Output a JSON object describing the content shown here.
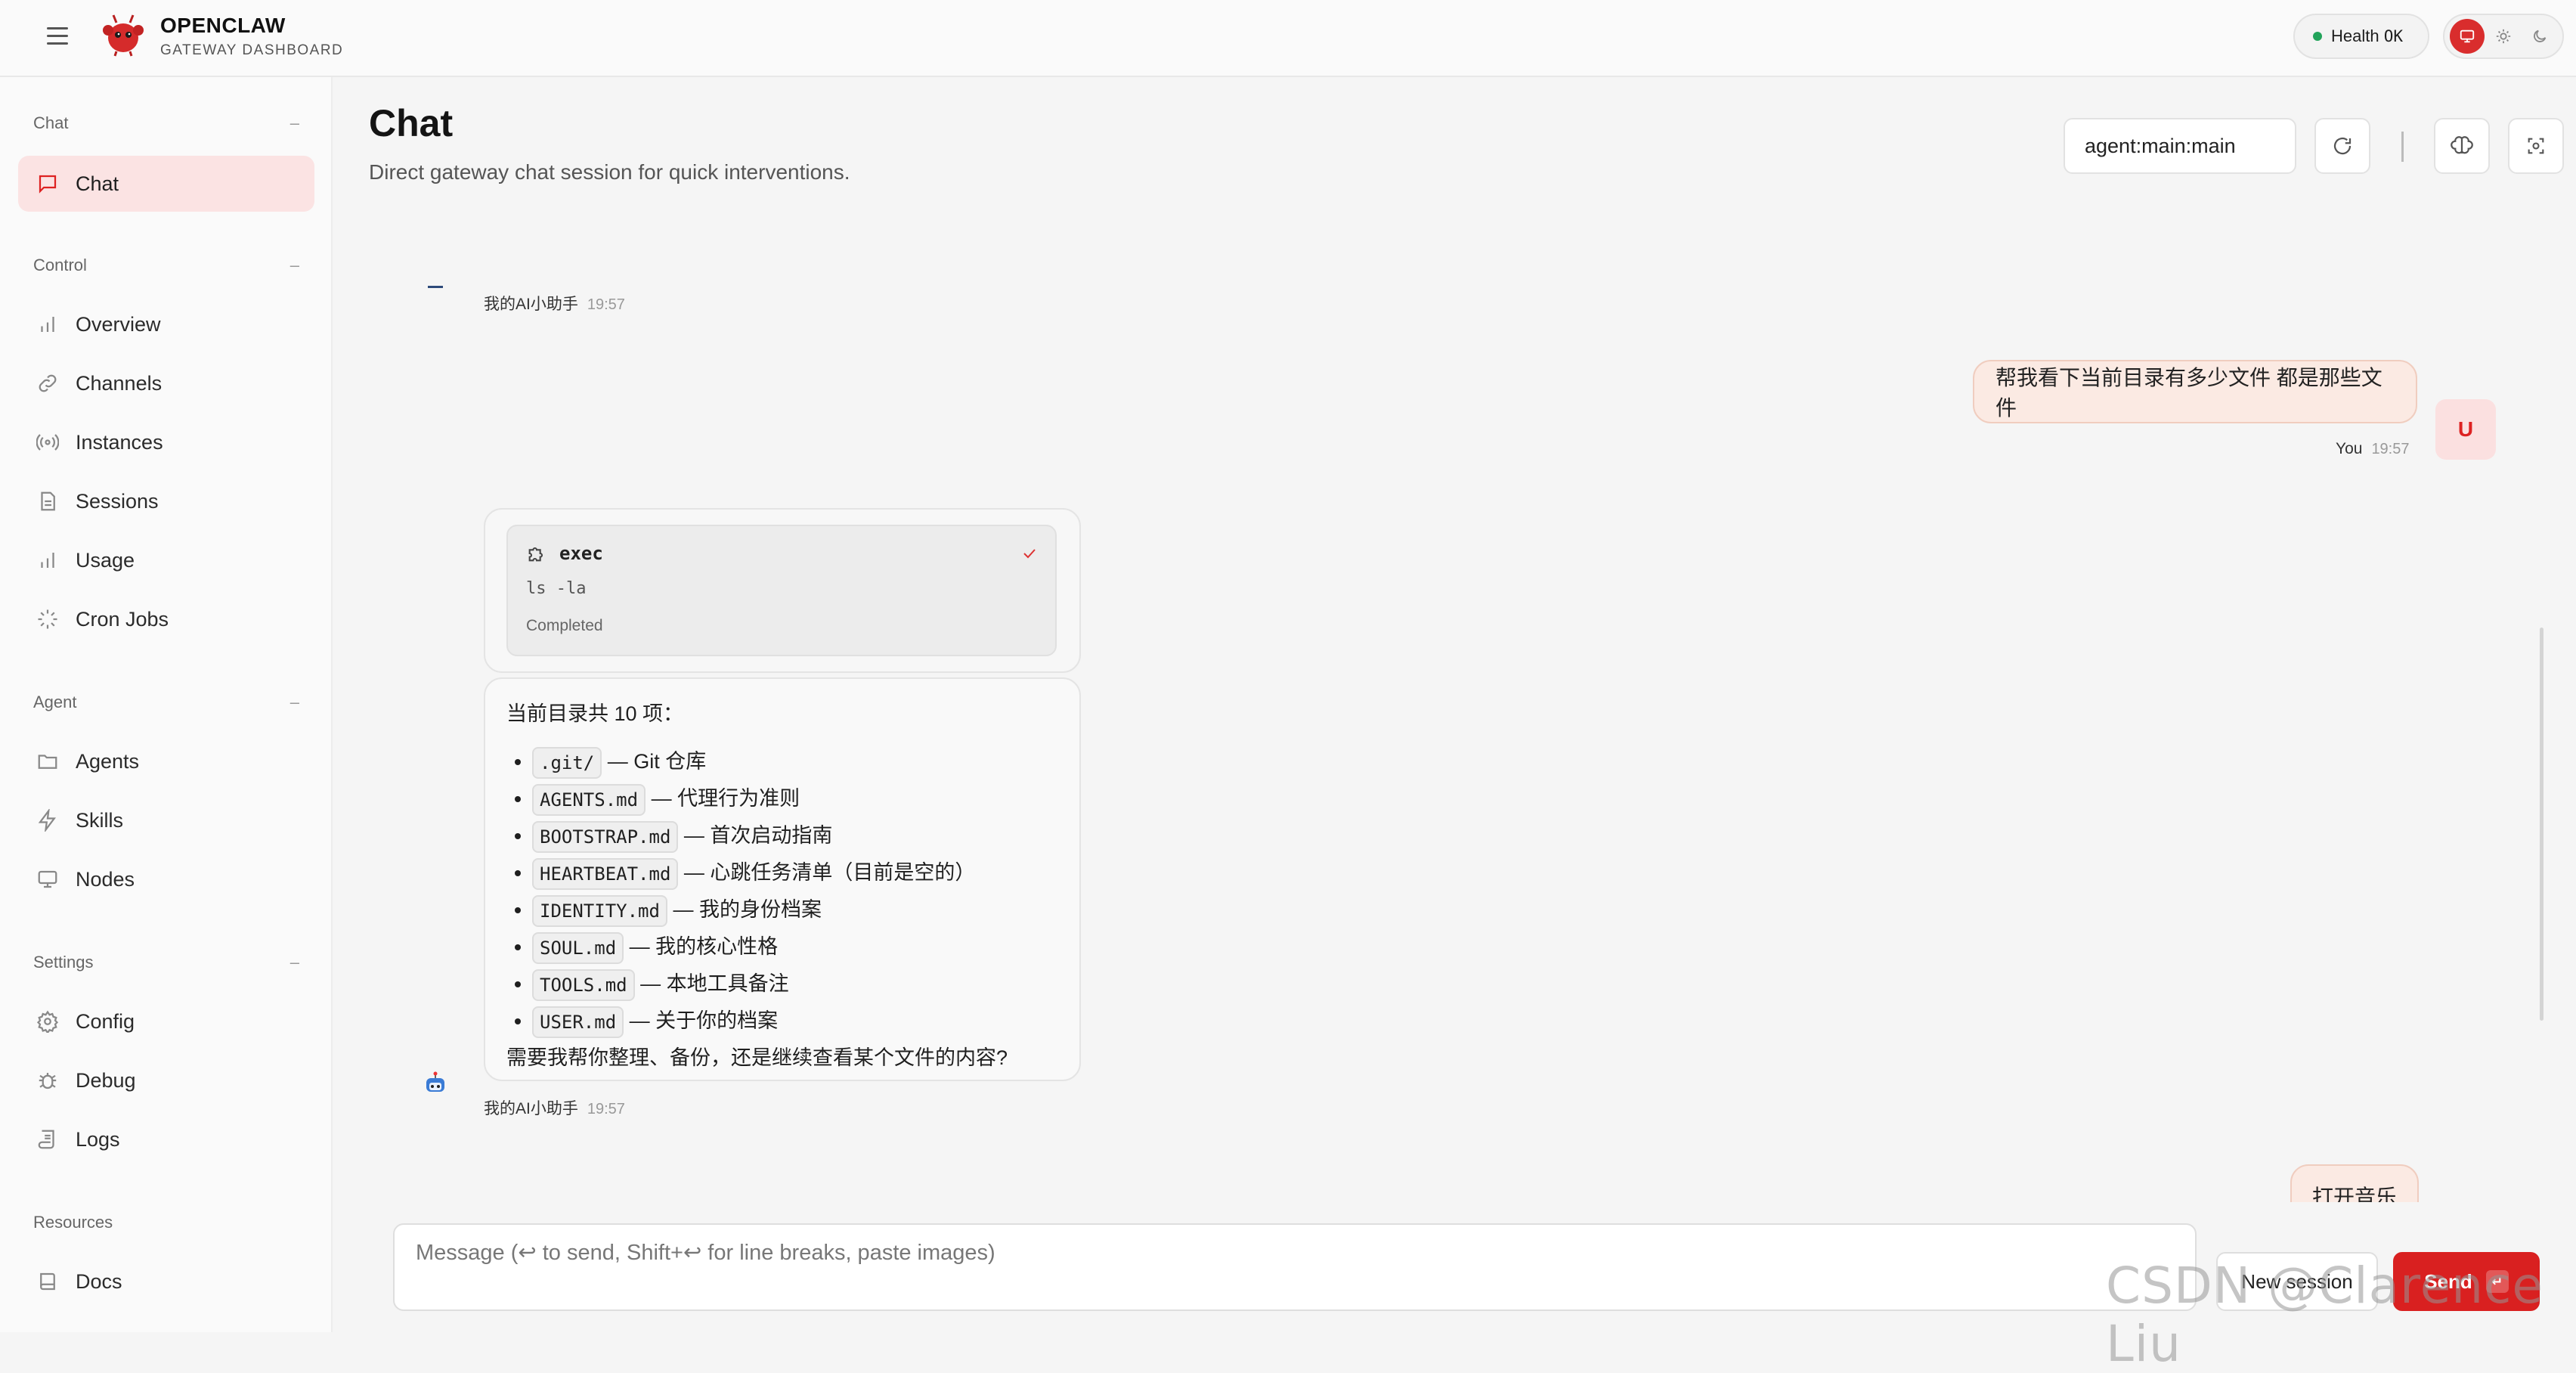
{
  "app": {
    "title": "OPENCLAW",
    "subtitle": "GATEWAY DASHBOARD",
    "health_label": "Health",
    "health_status": "OK",
    "accent": "#d92020"
  },
  "sidebar": {
    "sections": [
      {
        "title": "Chat",
        "collapse": "–"
      },
      {
        "title": "Control",
        "collapse": "–"
      },
      {
        "title": "Agent",
        "collapse": "–"
      },
      {
        "title": "Settings",
        "collapse": "–"
      },
      {
        "title": "Resources"
      }
    ],
    "items": [
      {
        "label": "Chat",
        "icon": "message-icon",
        "active": true
      },
      {
        "label": "Overview",
        "icon": "bar-chart-icon"
      },
      {
        "label": "Channels",
        "icon": "link-icon"
      },
      {
        "label": "Instances",
        "icon": "broadcast-icon"
      },
      {
        "label": "Sessions",
        "icon": "file-icon"
      },
      {
        "label": "Usage",
        "icon": "bar-chart-icon"
      },
      {
        "label": "Cron Jobs",
        "icon": "loader-icon"
      },
      {
        "label": "Agents",
        "icon": "folder-icon"
      },
      {
        "label": "Skills",
        "icon": "zap-icon"
      },
      {
        "label": "Nodes",
        "icon": "monitor-icon"
      },
      {
        "label": "Config",
        "icon": "gear-icon"
      },
      {
        "label": "Debug",
        "icon": "bug-icon"
      },
      {
        "label": "Logs",
        "icon": "scroll-icon"
      },
      {
        "label": "Docs",
        "icon": "book-icon"
      }
    ]
  },
  "page": {
    "title": "Chat",
    "subtitle": "Direct gateway chat session for quick interventions.",
    "session_key": "agent:main:main"
  },
  "messages": {
    "bot_name": "我的AI小助手",
    "first_time": "19:57",
    "user_msg": "帮我看下当前目录有多少文件 都是那些文件",
    "user_name": "You",
    "user_time": "19:57",
    "user_avatar": "U",
    "tool": {
      "name": "exec",
      "command": "ls -la",
      "status": "Completed"
    },
    "answer_intro": "当前目录共 10 项：",
    "files": [
      {
        "name": ".git/",
        "desc": "— Git 仓库"
      },
      {
        "name": "AGENTS.md",
        "desc": "— 代理行为准则"
      },
      {
        "name": "BOOTSTRAP.md",
        "desc": "— 首次启动指南"
      },
      {
        "name": "HEARTBEAT.md",
        "desc": "— 心跳任务清单（目前是空的）"
      },
      {
        "name": "IDENTITY.md",
        "desc": "— 我的身份档案"
      },
      {
        "name": "SOUL.md",
        "desc": "— 我的核心性格"
      },
      {
        "name": "TOOLS.md",
        "desc": "— 本地工具备注"
      },
      {
        "name": "USER.md",
        "desc": "— 关于你的档案"
      }
    ],
    "answer_outro": "需要我帮你整理、备份，还是继续查看某个文件的内容?",
    "second_time": "19:57",
    "partial_user_msg": "打开音乐"
  },
  "composer": {
    "placeholder": "Message (↩ to send, Shift+↩ for line breaks, paste images)",
    "new_session": "New session",
    "send": "Send",
    "send_key": "↵"
  },
  "watermark": "CSDN @Clarence Liu"
}
